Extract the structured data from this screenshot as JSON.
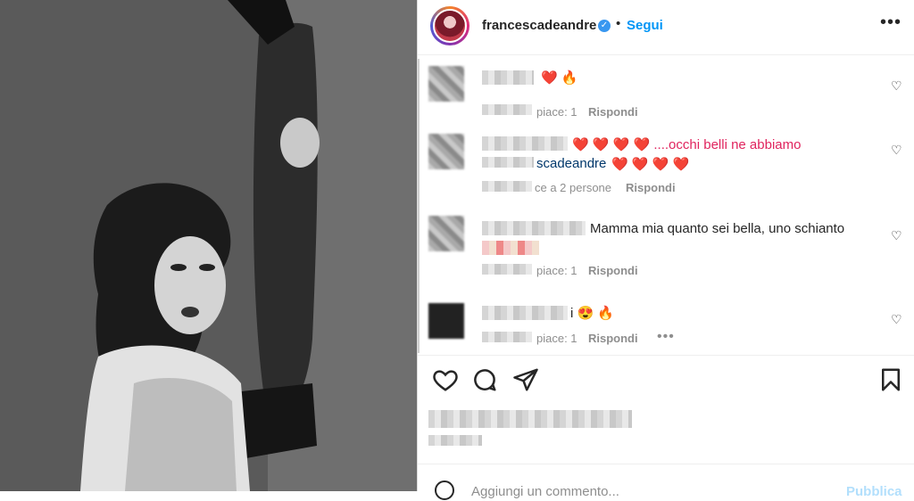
{
  "post": {
    "username": "francescadeandre",
    "follow_label": "Segui",
    "dot": "•",
    "more_label": "•••"
  },
  "comments": [
    {
      "text_tail": "❤️ 🔥",
      "meta": "piace: 1",
      "reply": "Rispondi"
    },
    {
      "text_tail": "❤️ ❤️ ❤️ ❤️ ....occhi belli ne abbiamo",
      "mention_tail": "scadeandre",
      "mention_emoji": "❤️ ❤️ ❤️ ❤️",
      "meta": "ce a 2 persone",
      "reply": "Rispondi"
    },
    {
      "text_tail": "Mamma mia quanto sei bella, uno schianto",
      "meta": "piace: 1",
      "reply": "Rispondi"
    },
    {
      "text_tail": "i 😍 🔥",
      "meta": "piace: 1",
      "reply": "Rispondi",
      "more": "•••"
    }
  ],
  "actions": {
    "like": "like-icon",
    "comment": "comment-icon",
    "share": "share-icon",
    "save": "save-icon"
  },
  "add_comment": {
    "placeholder": "Aggiungi un commento...",
    "publish": "Pubblica"
  },
  "colors": {
    "accent": "#0095f6",
    "publish_disabled": "#b2dffc",
    "heart": "#e0245e"
  }
}
